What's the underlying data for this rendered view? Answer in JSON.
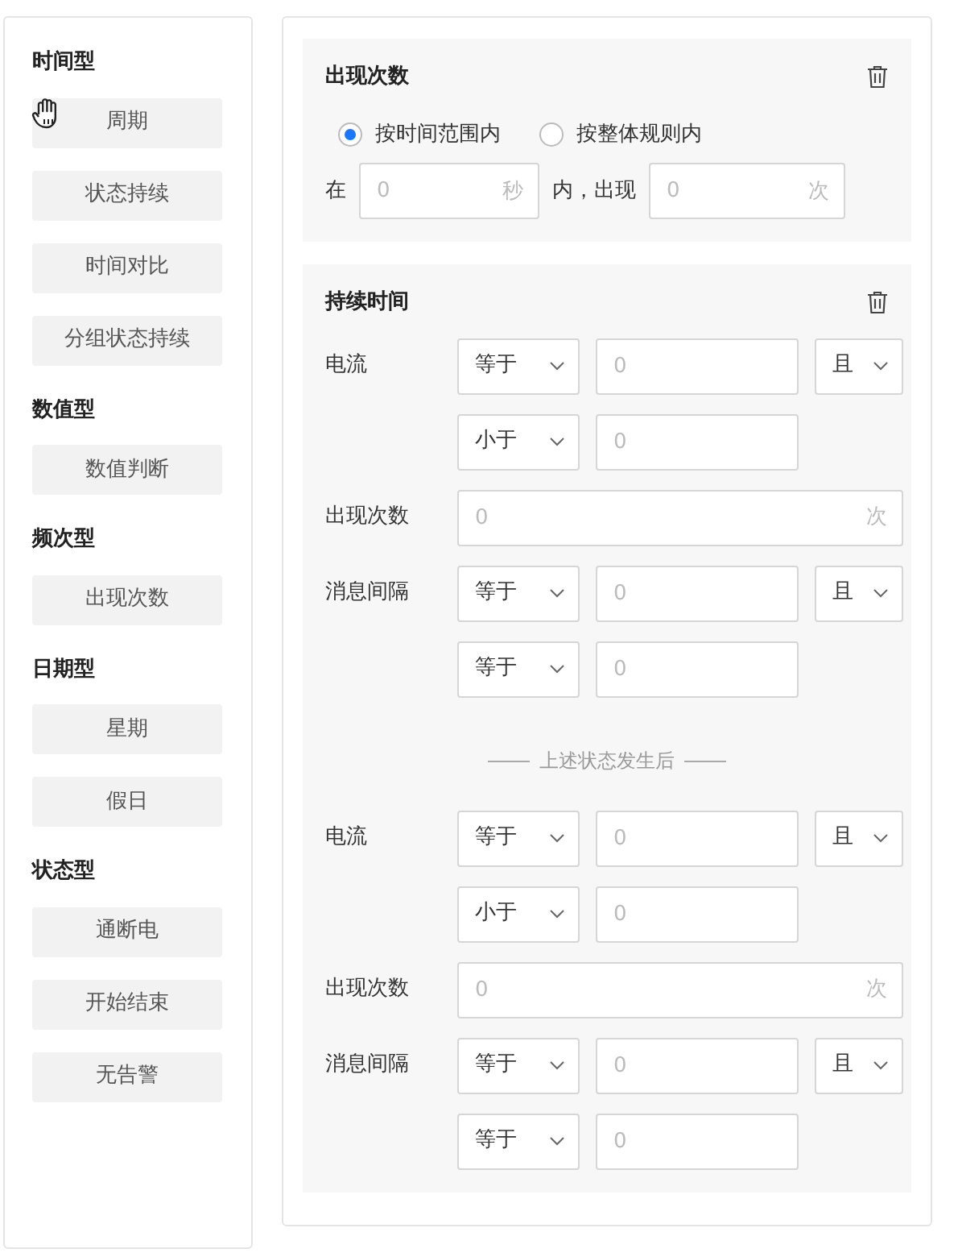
{
  "sidebar": {
    "groups": [
      {
        "title": "时间型",
        "items": [
          "周期",
          "状态持续",
          "时间对比",
          "分组状态持续"
        ]
      },
      {
        "title": "数值型",
        "items": [
          "数值判断"
        ]
      },
      {
        "title": "频次型",
        "items": [
          "出现次数"
        ]
      },
      {
        "title": "日期型",
        "items": [
          "星期",
          "假日"
        ]
      },
      {
        "title": "状态型",
        "items": [
          "通断电",
          "开始结束",
          "无告警"
        ]
      }
    ]
  },
  "cards": [
    {
      "kind": "count",
      "title": "出现次数",
      "radios": [
        {
          "label": "按时间范围内",
          "selected": true
        },
        {
          "label": "按整体规则内",
          "selected": false
        }
      ],
      "range": {
        "prefix": "在",
        "first": {
          "placeholder": "0",
          "unit": "秒"
        },
        "middle": "内，出现",
        "second": {
          "placeholder": "0",
          "unit": "次"
        }
      }
    },
    {
      "kind": "duration",
      "title": "持续时间",
      "items": [
        {
          "kind": "condition",
          "label": "电流",
          "conditions": [
            {
              "operator": "等于",
              "placeholder": "0"
            },
            {
              "operator": "小于",
              "placeholder": "0"
            }
          ],
          "logic": "且"
        },
        {
          "kind": "count",
          "label": "出现次数",
          "placeholder": "0",
          "unit": "次"
        },
        {
          "kind": "condition",
          "label": "消息间隔",
          "conditions": [
            {
              "operator": "等于",
              "placeholder": "0"
            },
            {
              "operator": "等于",
              "placeholder": "0"
            }
          ],
          "logic": "且"
        },
        {
          "kind": "divider",
          "text": "上述状态发生后"
        },
        {
          "kind": "condition",
          "label": "电流",
          "conditions": [
            {
              "operator": "等于",
              "placeholder": "0"
            },
            {
              "operator": "小于",
              "placeholder": "0"
            }
          ],
          "logic": "且"
        },
        {
          "kind": "count",
          "label": "出现次数",
          "placeholder": "0",
          "unit": "次"
        },
        {
          "kind": "condition",
          "label": "消息间隔",
          "conditions": [
            {
              "operator": "等于",
              "placeholder": "0"
            },
            {
              "operator": "等于",
              "placeholder": "0"
            }
          ],
          "logic": "且"
        }
      ]
    }
  ]
}
